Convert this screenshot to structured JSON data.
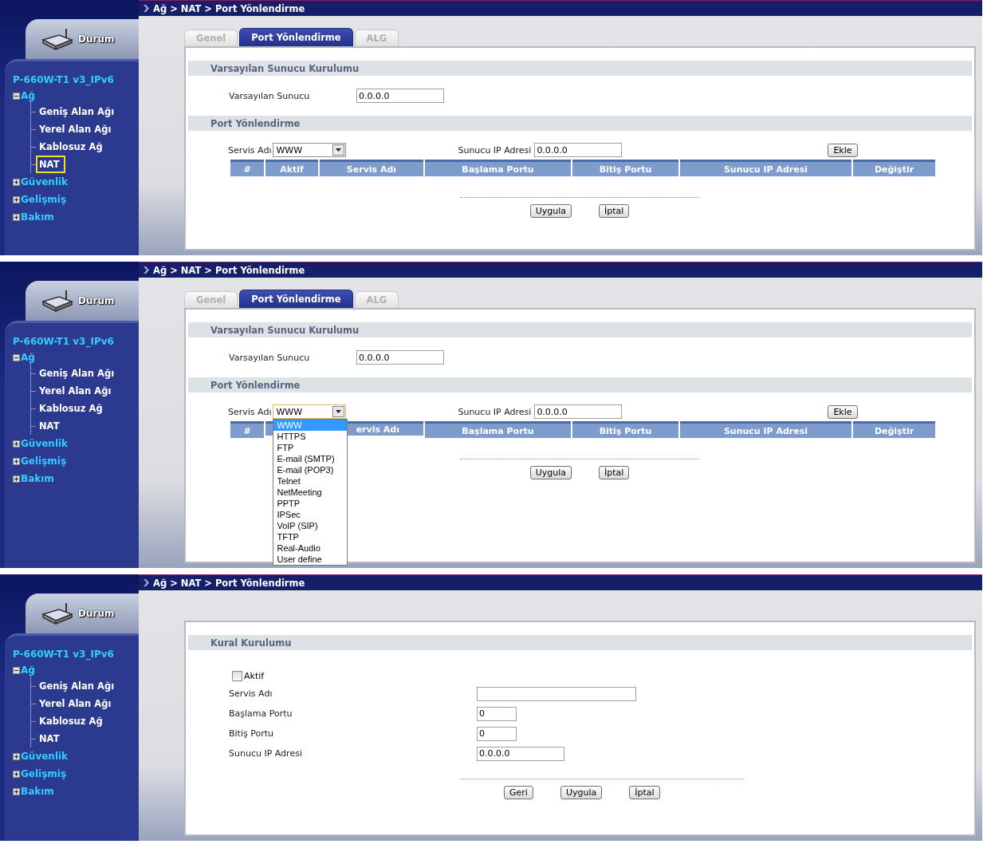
{
  "screens": [
    {
      "kind": "port-list",
      "breadcrumb": "Ağ > NAT > Port Yönlendirme",
      "status_tab": "Durum",
      "model": "P-660W-T1 v3_IPv6",
      "menu": [
        {
          "label": "Ağ",
          "expanded": true,
          "children": [
            {
              "label": "Geniş Alan Ağı",
              "selected": false
            },
            {
              "label": "Yerel Alan Ağı",
              "selected": false
            },
            {
              "label": "Kablosuz Ağ",
              "selected": false
            },
            {
              "label": "NAT",
              "selected": true
            }
          ]
        },
        {
          "label": "Güvenlik",
          "expanded": false
        },
        {
          "label": "Gelişmiş",
          "expanded": false
        },
        {
          "label": "Bakım",
          "expanded": false
        }
      ],
      "tabs": [
        {
          "label": "Genel",
          "selected": false
        },
        {
          "label": "Port Yönlendirme",
          "selected": true
        },
        {
          "label": "ALG",
          "selected": false
        }
      ],
      "default_server": {
        "title": "Varsayılan Sunucu Kurulumu",
        "label": "Varsayılan Sunucu",
        "value": "0.0.0.0"
      },
      "port_forwarding": {
        "title": "Port Yönlendirme",
        "service_label": "Servis Adı",
        "service_value": "WWW",
        "ip_label": "Sunucu IP Adresi",
        "ip_value": "0.0.0.0",
        "add_button": "Ekle",
        "columns": [
          {
            "label": "#"
          },
          {
            "label": "Aktif"
          },
          {
            "label": "Servis Adı"
          },
          {
            "label": "Başlama Portu"
          },
          {
            "label": "Bitiş Portu"
          },
          {
            "label": "Sunucu IP Adresi"
          },
          {
            "label": "Değiştir"
          }
        ],
        "buttons": [
          "Uygula",
          "İptal"
        ]
      }
    },
    {
      "kind": "port-list",
      "breadcrumb": "Ağ > NAT > Port Yönlendirme",
      "status_tab": "Durum",
      "model": "P-660W-T1 v3_IPv6",
      "menu": [
        {
          "label": "Ağ",
          "expanded": true,
          "children": [
            {
              "label": "Geniş Alan Ağı",
              "selected": false
            },
            {
              "label": "Yerel Alan Ağı",
              "selected": false
            },
            {
              "label": "Kablosuz Ağ",
              "selected": false
            },
            {
              "label": "NAT",
              "selected": false
            }
          ]
        },
        {
          "label": "Güvenlik",
          "expanded": false
        },
        {
          "label": "Gelişmiş",
          "expanded": false
        },
        {
          "label": "Bakım",
          "expanded": false
        }
      ],
      "tabs": [
        {
          "label": "Genel",
          "selected": false
        },
        {
          "label": "Port Yönlendirme",
          "selected": true
        },
        {
          "label": "ALG",
          "selected": false
        }
      ],
      "default_server": {
        "title": "Varsayılan Sunucu Kurulumu",
        "label": "Varsayılan Sunucu",
        "value": "0.0.0.0"
      },
      "port_forwarding": {
        "title": "Port Yönlendirme",
        "service_label": "Servis Adı",
        "service_value": "WWW",
        "ip_label": "Sunucu IP Adresi",
        "ip_value": "0.0.0.0",
        "add_button": "Ekle",
        "columns": [
          {
            "label": "#"
          },
          {
            "covered": true
          },
          {
            "label": "ervis Adı",
            "covered": true
          },
          {
            "label": "Başlama Portu"
          },
          {
            "label": "Bitiş Portu"
          },
          {
            "label": "Sunucu IP Adresi"
          },
          {
            "label": "Değiştir"
          }
        ],
        "buttons": [
          "Uygula",
          "İptal"
        ],
        "dropdown": [
          {
            "label": "WWW",
            "selected": true
          },
          {
            "label": "HTTPS",
            "selected": false
          },
          {
            "label": "FTP",
            "selected": false
          },
          {
            "label": "E-mail (SMTP)",
            "selected": false
          },
          {
            "label": "E-mail (POP3)",
            "selected": false
          },
          {
            "label": "Telnet",
            "selected": false
          },
          {
            "label": "NetMeeting",
            "selected": false
          },
          {
            "label": "PPTP",
            "selected": false
          },
          {
            "label": "IPSec",
            "selected": false
          },
          {
            "label": "VoIP (SIP)",
            "selected": false
          },
          {
            "label": "TFTP",
            "selected": false
          },
          {
            "label": "Real-Audio",
            "selected": false
          },
          {
            "label": "User define",
            "selected": false
          }
        ]
      }
    },
    {
      "kind": "rule-form",
      "breadcrumb": "Ağ > NAT > Port Yönlendirme",
      "status_tab": "Durum",
      "model": "P-660W-T1 v3_IPv6",
      "menu": [
        {
          "label": "Ağ",
          "expanded": true,
          "children": [
            {
              "label": "Geniş Alan Ağı",
              "selected": false
            },
            {
              "label": "Yerel Alan Ağı",
              "selected": false
            },
            {
              "label": "Kablosuz Ağ",
              "selected": false
            },
            {
              "label": "NAT",
              "selected": false
            }
          ]
        },
        {
          "label": "Güvenlik",
          "expanded": false
        },
        {
          "label": "Gelişmiş",
          "expanded": false
        },
        {
          "label": "Bakım",
          "expanded": false
        }
      ],
      "rule": {
        "title": "Kural Kurulumu",
        "active_label": "Aktif",
        "checked": false,
        "fields": [
          {
            "label": "Servis Adı",
            "kind": "wide"
          },
          {
            "label": "Başlama Portu",
            "value": "0",
            "kind": "short"
          },
          {
            "label": "Bitiş Portu",
            "value": "0",
            "kind": "short"
          },
          {
            "label": "Sunucu IP Adresi",
            "value": "0.0.0.0",
            "kind": "medium"
          }
        ],
        "buttons": [
          "Geri",
          "Uygula",
          "İptal"
        ]
      }
    }
  ]
}
